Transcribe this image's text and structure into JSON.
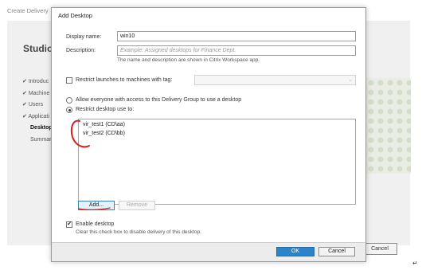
{
  "background": {
    "title": "Create Delivery",
    "studio": "Studio",
    "nav_items": [
      {
        "label": "Introduc",
        "icon": "checkmark-icon",
        "active": false
      },
      {
        "label": "Machine",
        "icon": "checkmark-icon",
        "active": false
      },
      {
        "label": "Users",
        "icon": "checkmark-icon",
        "active": false
      },
      {
        "label": "Applicati",
        "icon": "checkmark-icon",
        "active": false
      },
      {
        "label": "Desktop",
        "icon": "",
        "active": true
      },
      {
        "label": "Summar",
        "icon": "",
        "active": false
      }
    ],
    "cancel_label": "Cancel"
  },
  "dialog": {
    "title": "Add Desktop",
    "display_name_label": "Display name:",
    "display_name_value": "win10",
    "description_label": "Description:",
    "description_placeholder": "Example: Assigned desktops for Finance Dept.",
    "description_hint": "The name and description are shown in Citrix Workspace app.",
    "restrict_tag_label": "Restrict launches to machines with tag:",
    "restrict_tag_checked": false,
    "allow_everyone_label": "Allow everyone with access to this Delivery Group to use a desktop",
    "restrict_use_label": "Restrict desktop use to:",
    "selected_access": "restrict",
    "users": [
      "vir_test1 (CD\\aa)",
      "vir_test2 (CD\\bb)"
    ],
    "add_label": "Add...",
    "remove_label": "Remove",
    "enable_label": "Enable desktop",
    "enable_checked": true,
    "enable_hint": "Clear this check box to disable delivery of this desktop.",
    "ok_label": "OK",
    "cancel_label": "Cancel"
  },
  "colors": {
    "primary_button": "#2b83c9",
    "annotation": "#d42020"
  }
}
